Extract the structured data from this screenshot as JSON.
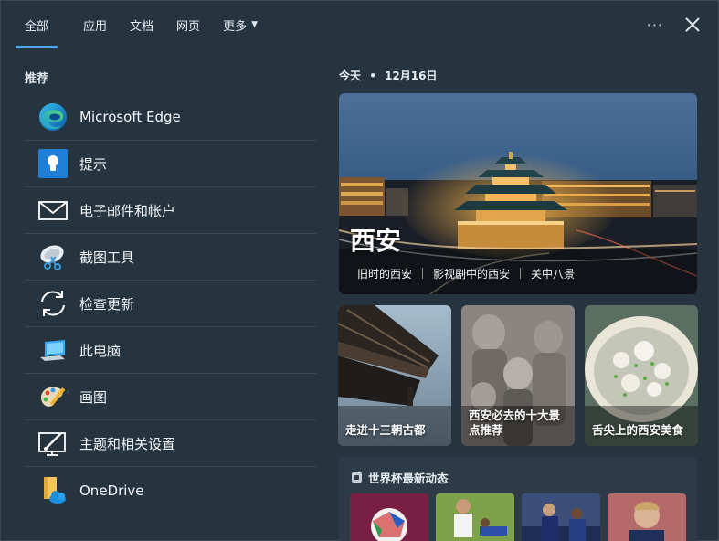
{
  "nav": {
    "tabs": [
      {
        "label": "全部",
        "active": true
      },
      {
        "label": "应用",
        "active": false
      },
      {
        "label": "文档",
        "active": false
      },
      {
        "label": "网页",
        "active": false
      },
      {
        "label": "更多",
        "active": false
      }
    ],
    "more_icon": "ellipsis-icon",
    "close_icon": "close-icon"
  },
  "recommend": {
    "title": "推荐",
    "apps": [
      {
        "label": "Microsoft Edge",
        "icon": "edge-icon"
      },
      {
        "label": "提示",
        "icon": "tips-icon"
      },
      {
        "label": "电子邮件和帐户",
        "icon": "mail-icon"
      },
      {
        "label": "截图工具",
        "icon": "snipping-tool-icon"
      },
      {
        "label": "检查更新",
        "icon": "refresh-icon"
      },
      {
        "label": "此电脑",
        "icon": "computer-icon"
      },
      {
        "label": "画图",
        "icon": "paint-icon"
      },
      {
        "label": "主题和相关设置",
        "icon": "theme-settings-icon"
      },
      {
        "label": "OneDrive",
        "icon": "onedrive-icon"
      }
    ]
  },
  "today": {
    "label": "今天",
    "dot": "•",
    "date": "12月16日"
  },
  "hero": {
    "title": "西安",
    "links": [
      "旧时的西安",
      "影视剧中的西安",
      "关中八景"
    ]
  },
  "cards": [
    {
      "title": "走进十三朝古都"
    },
    {
      "title": "西安必去的十大景点推荐"
    },
    {
      "title": "舌尖上的西安美食"
    }
  ],
  "worldcup": {
    "title": "世界杯最新动态"
  },
  "colors": {
    "background": "#263440",
    "accent": "#4ea6f2",
    "divider": "#3a4855"
  }
}
